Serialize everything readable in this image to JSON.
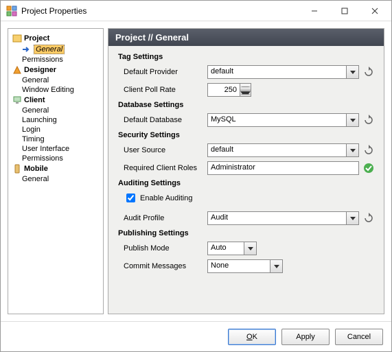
{
  "window": {
    "title": "Project Properties"
  },
  "tree": {
    "n0": {
      "label": "Project"
    },
    "n0c": {
      "c0": "General",
      "c1": "Permissions"
    },
    "n1": {
      "label": "Designer"
    },
    "n1c": {
      "c0": "General",
      "c1": "Window Editing"
    },
    "n2": {
      "label": "Client"
    },
    "n2c": {
      "c0": "General",
      "c1": "Launching",
      "c2": "Login",
      "c3": "Timing",
      "c4": "User Interface",
      "c5": "Permissions"
    },
    "n3": {
      "label": "Mobile"
    },
    "n3c": {
      "c0": "General"
    }
  },
  "header": {
    "title": "Project // General"
  },
  "sections": {
    "tag": "Tag Settings",
    "db": "Database Settings",
    "sec": "Security Settings",
    "aud": "Auditing Settings",
    "pub": "Publishing Settings"
  },
  "labels": {
    "defaultProvider": "Default Provider",
    "clientPollRate": "Client Poll Rate",
    "defaultDatabase": "Default Database",
    "userSource": "User Source",
    "requiredClientRoles": "Required Client Roles",
    "enableAuditing": "Enable Auditing",
    "auditProfile": "Audit Profile",
    "publishMode": "Publish Mode",
    "commitMessages": "Commit Messages"
  },
  "values": {
    "defaultProvider": "default",
    "clientPollRate": "250",
    "defaultDatabase": "MySQL",
    "userSource": "default",
    "requiredClientRoles": "Administrator",
    "auditProfile": "Audit",
    "publishMode": "Auto",
    "commitMessages": "None"
  },
  "buttons": {
    "ok": "OK",
    "apply": "Apply",
    "cancel": "Cancel"
  }
}
